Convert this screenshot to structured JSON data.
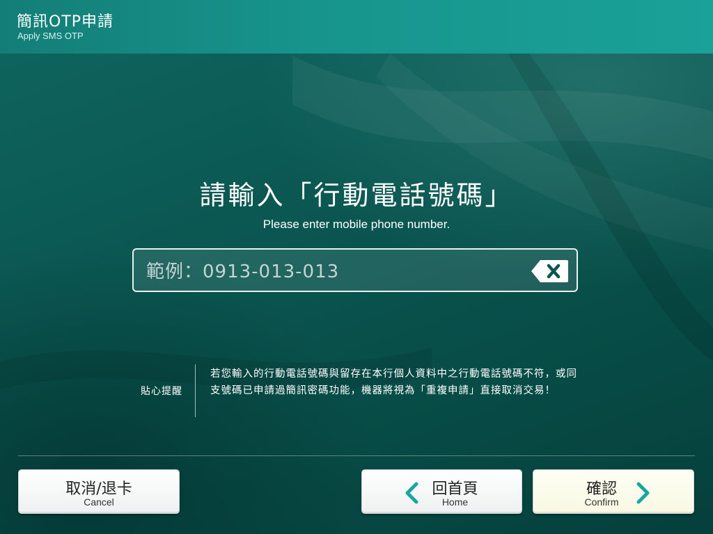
{
  "header": {
    "title": "簡訊OTP申請",
    "subtitle": "Apply SMS OTP"
  },
  "prompt": {
    "title": "請輸入「行動電話號碼」",
    "subtitle": "Please enter mobile phone number."
  },
  "phone_input": {
    "placeholder": "範例：0913-013-013",
    "value": "",
    "clear_icon": "backspace-clear-icon"
  },
  "notice": {
    "label": "貼心提醒",
    "text": "若您輸入的行動電話號碼與留存在本行個人資料中之行動電話號碼不符，或同支號碼已申請過簡訊密碼功能，機器將視為「重複申請」直接取消交易！"
  },
  "buttons": {
    "cancel": {
      "label": "取消/退卡",
      "sublabel": "Cancel"
    },
    "home": {
      "label": "回首頁",
      "sublabel": "Home",
      "icon": "chevron-left-icon"
    },
    "confirm": {
      "label": "確認",
      "sublabel": "Confirm",
      "icon": "chevron-right-icon"
    }
  },
  "colors": {
    "background": "#0b5752",
    "header": "#17958d",
    "accent": "#1aa6a0",
    "confirm_button": "#fbfbe8"
  }
}
